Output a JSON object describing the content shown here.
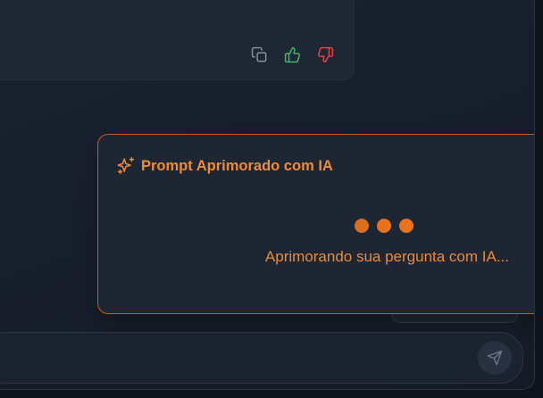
{
  "message": {
    "actions": [
      {
        "name": "copy-icon",
        "color": "#8a93a3"
      },
      {
        "name": "thumbs-up-icon",
        "color": "#3bbf6e"
      },
      {
        "name": "thumbs-down-icon",
        "color": "#e5484d"
      }
    ]
  },
  "ai_prompt": {
    "icon": "sparkles-icon",
    "title": "Prompt Aprimorado com IA",
    "status": "Aprimorando sua pergunta com IA...",
    "loading_dots": 3,
    "accent_color": "#e8721e"
  },
  "composer": {
    "value": "",
    "placeholder": "",
    "send_icon": "send-icon"
  }
}
